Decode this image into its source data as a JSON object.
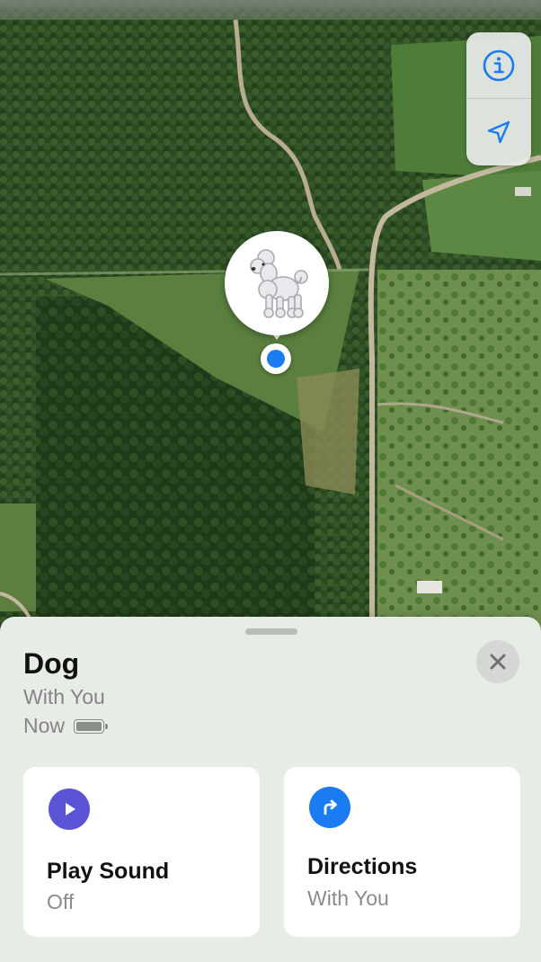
{
  "colors": {
    "play_icon_bg": "#5b54d6",
    "directions_icon_bg": "#1a7cf0",
    "location_dot": "#1a7cf0",
    "map_control_icon": "#1a7cf0"
  },
  "map": {
    "controls": [
      {
        "name": "info",
        "icon": "info-circle-icon"
      },
      {
        "name": "location",
        "icon": "location-arrow-icon"
      }
    ],
    "pin": {
      "emoji": "🐩"
    }
  },
  "sheet": {
    "title": "Dog",
    "subtitle": "With You",
    "time": "Now",
    "battery_level": 1.0,
    "actions": [
      {
        "label": "Play Sound",
        "sub": "Off",
        "icon": "play-icon"
      },
      {
        "label": "Directions",
        "sub": "With You",
        "icon": "directions-arrow-icon"
      }
    ]
  }
}
